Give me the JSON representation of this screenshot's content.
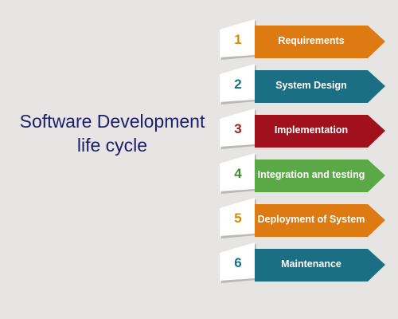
{
  "title_lines": [
    "Software Development",
    "life cycle"
  ],
  "colors": {
    "background": "#e6e5e3",
    "title_text": "#1c1c6b",
    "label_text": "#ffffff"
  },
  "steps": [
    {
      "number": "1",
      "label": "Requirements",
      "color": "#dd7a12",
      "number_color": "#d68a10"
    },
    {
      "number": "2",
      "label": "System Design",
      "color": "#1a6f84",
      "number_color": "#1a6f84"
    },
    {
      "number": "3",
      "label": "Implementation",
      "color": "#a0101d",
      "number_color": "#a02020"
    },
    {
      "number": "4",
      "label": "Integration and testing",
      "color": "#5ba946",
      "number_color": "#3c8f2c"
    },
    {
      "number": "5",
      "label": "Deployment of System",
      "color": "#dd7a12",
      "number_color": "#d68a10"
    },
    {
      "number": "6",
      "label": "Maintenance",
      "color": "#1a6f84",
      "number_color": "#1a6f84"
    }
  ]
}
